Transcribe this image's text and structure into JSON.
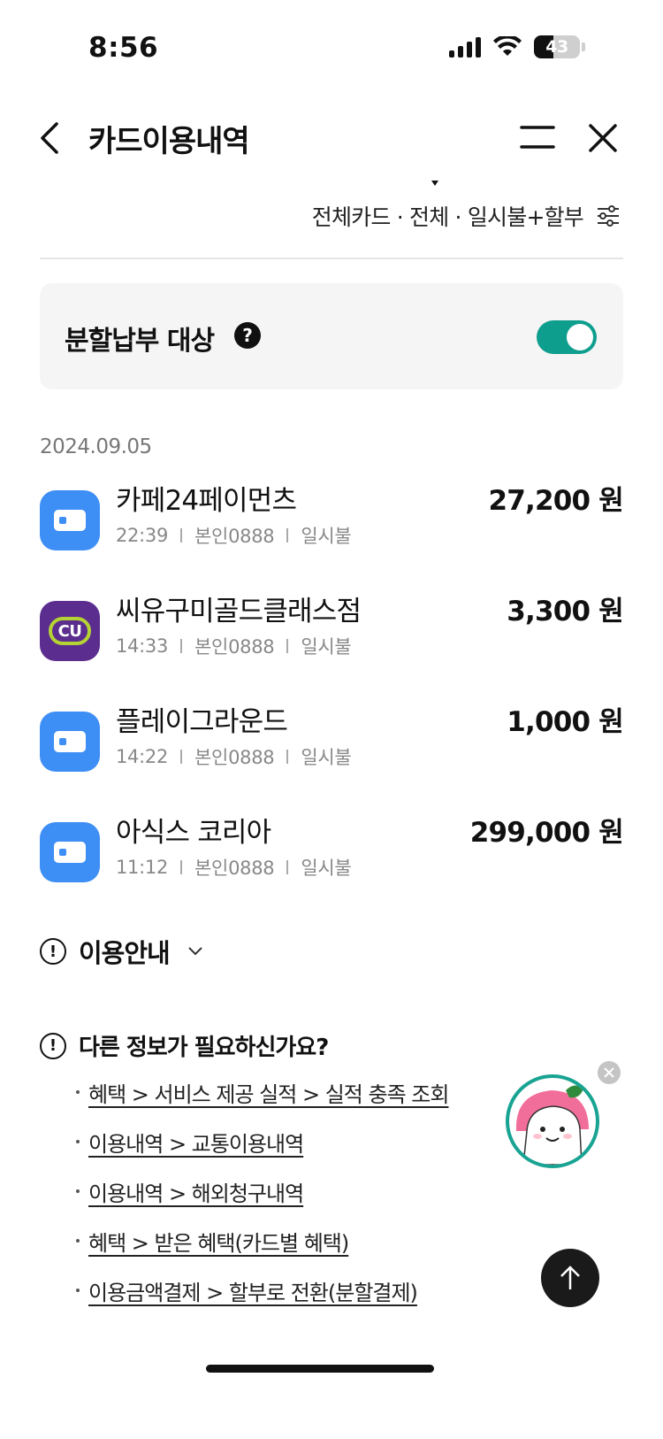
{
  "status_bar": {
    "time": "8:56",
    "battery": "43",
    "battery_level": 0.43
  },
  "header": {
    "title": "카드이용내역"
  },
  "filter": {
    "summary": "전체카드 · 전체 · 일시불+할부"
  },
  "installment": {
    "label": "분할납부 대상",
    "help": "?",
    "enabled": true
  },
  "date": "2024.09.05",
  "transactions": [
    {
      "merchant": "카페24페이먼츠",
      "time": "22:39",
      "owner": "본인0888",
      "type": "일시불",
      "amount": "27,200 원",
      "icon": "card-icon"
    },
    {
      "merchant": "씨유구미골드클래스점",
      "time": "14:33",
      "owner": "본인0888",
      "type": "일시불",
      "amount": "3,300 원",
      "icon": "cu-logo",
      "logo_text": "CU"
    },
    {
      "merchant": "플레이그라운드",
      "time": "14:22",
      "owner": "본인0888",
      "type": "일시불",
      "amount": "1,000 원",
      "icon": "card-icon"
    },
    {
      "merchant": "아식스 코리아",
      "time": "11:12",
      "owner": "본인0888",
      "type": "일시불",
      "amount": "299,000 원",
      "icon": "card-icon"
    }
  ],
  "usage_guide": {
    "label": "이용안내",
    "info_glyph": "!"
  },
  "more_info": {
    "title": "다른 정보가 필요하신가요?",
    "links": [
      "혜택 > 서비스 제공 실적 > 실적 충족 조회",
      "이용내역 > 교통이용내역",
      "이용내역 > 해외청구내역",
      "혜택 > 받은 혜택(카드별 혜택)",
      "이용금액결제 > 할부로 전환(분할결제)"
    ]
  },
  "colors": {
    "accent": "#0e9e8e",
    "card_icon": "#3d8ef5",
    "cu_purple": "#5b2d8e",
    "cu_green": "#b5d334"
  }
}
